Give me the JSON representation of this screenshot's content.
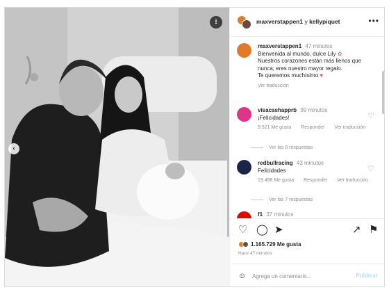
{
  "post": {
    "header": {
      "user1": "maxverstappen1",
      "joiner": "y",
      "user2": "kellypiquet",
      "more_icon": "more-horizontal-icon"
    },
    "caption": {
      "user": "maxverstappen1",
      "time": "47 minutos",
      "line1": "Bienvenida al mundo, dulce Lily",
      "line2": "Nuestros corazones están más llenos que nunca; eres nuestro mayor regalo.",
      "line3": "Te queremos muchísimo",
      "translation": "Ver traducción"
    },
    "comments": [
      {
        "user": "visacashapprb",
        "time": "39 minutos",
        "text": "¡Felicidades!",
        "likes": "9.521 Me gusta",
        "reply": "Responder",
        "translate": "Ver traducción",
        "replies": "Ver las 6 respuestas"
      },
      {
        "user": "redbullracing",
        "time": "43 minutos",
        "text": "Felicidades",
        "likes": "19.488 Me gusta",
        "reply": "Responder",
        "translate": "Ver traducción",
        "replies": "Ver las 7 respuestas"
      },
      {
        "user": "f1",
        "time": "37 minutos"
      }
    ],
    "likes_count": "1.165.729 Me gusta",
    "ago": "Hace 47 minutos",
    "comment_placeholder": "Agrega un comentario...",
    "publish_label": "Publicar"
  },
  "colors": {
    "border": "#dbdbdb",
    "muted": "#8e8e8e",
    "heart_red": "#ed4956",
    "publish_disabled": "#b2dffc"
  }
}
